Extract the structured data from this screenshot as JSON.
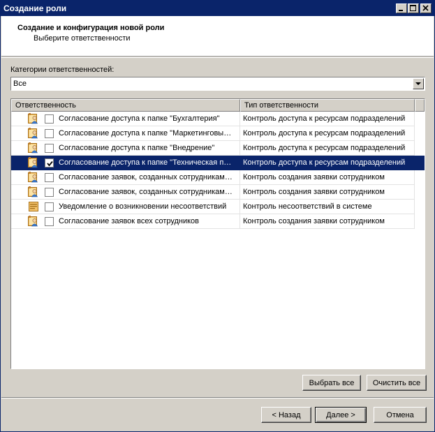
{
  "window": {
    "title": "Создание роли"
  },
  "header": {
    "title": "Создание и конфигурация новой роли",
    "subtitle": "Выберите ответственности"
  },
  "category": {
    "label": "Категории ответственностей:",
    "value": "Все"
  },
  "list": {
    "columns": [
      "Ответственность",
      "Тип ответственности"
    ],
    "rows": [
      {
        "name": "Согласование доступа к папке \"Бухгалтерия\"",
        "type": "Контроль доступа к ресурсам подразделений",
        "checked": false,
        "selected": false,
        "icon": "approval-icon"
      },
      {
        "name": "Согласование доступа к папке \"Маркетинговы…",
        "type": "Контроль доступа к ресурсам подразделений",
        "checked": false,
        "selected": false,
        "icon": "approval-icon"
      },
      {
        "name": "Согласование доступа к папке \"Внедрение\"",
        "type": "Контроль доступа к ресурсам подразделений",
        "checked": false,
        "selected": false,
        "icon": "approval-icon"
      },
      {
        "name": "Согласование доступа к папке \"Техническая п…",
        "type": "Контроль доступа к ресурсам подразделений",
        "checked": true,
        "selected": true,
        "icon": "approval-icon"
      },
      {
        "name": "Согласование заявок, созданных сотрудникам…",
        "type": "Контроль создания заявки сотрудником",
        "checked": false,
        "selected": false,
        "icon": "approval-icon"
      },
      {
        "name": "Согласование заявок, созданных сотрудникам…",
        "type": "Контроль создания заявки сотрудником",
        "checked": false,
        "selected": false,
        "icon": "approval-icon"
      },
      {
        "name": "Уведомление о возникновении несоответствий",
        "type": "Контроль несоответствий в системе",
        "checked": false,
        "selected": false,
        "icon": "notification-icon"
      },
      {
        "name": "Согласование заявок всех сотрудников",
        "type": "Контроль создания заявки сотрудником",
        "checked": false,
        "selected": false,
        "icon": "approval-icon"
      }
    ]
  },
  "buttons": {
    "select_all": "Выбрать все",
    "clear_all": "Очистить все",
    "back": "< Назад",
    "next": "Далее >",
    "cancel": "Отмена"
  },
  "colors": {
    "selection": "#0a246a",
    "face": "#d4d0c8"
  }
}
